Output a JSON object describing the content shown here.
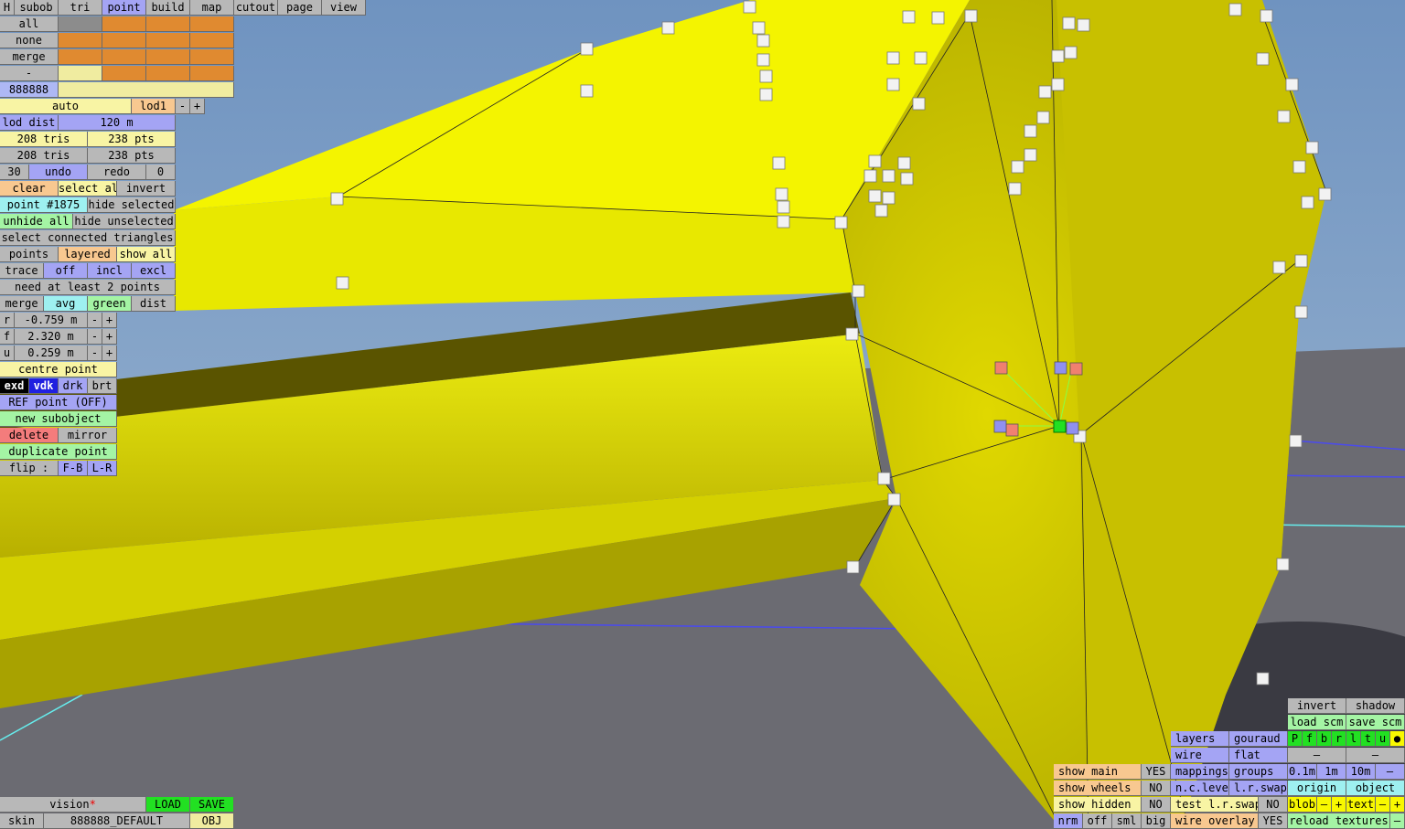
{
  "colors": {
    "sky": "#7a9cc4",
    "ground": "#6a6a72",
    "mesh": "#e8e800",
    "selected_point": "#22e022"
  },
  "menu": {
    "h": "H",
    "tabs": [
      "subob",
      "tri",
      "point",
      "build",
      "map",
      "cutout",
      "page",
      "view"
    ],
    "active": "point"
  },
  "select": {
    "all": "all",
    "none": "none",
    "merge": "merge",
    "dash": "-",
    "code": "888888"
  },
  "lod": {
    "auto": "auto",
    "name": "lod1",
    "minus": "-",
    "plus": "+",
    "dist_label": "lod dist",
    "dist_value": "120 m"
  },
  "stats": {
    "tris1": "208 tris",
    "pts1": "238 pts",
    "tris2": "208 tris",
    "pts2": "238 pts"
  },
  "undo": {
    "count": "30",
    "undo": "undo",
    "redo": "redo",
    "redo_count": "0"
  },
  "sel": {
    "clear": "clear",
    "select_all": "select all",
    "invert": "invert",
    "point": "point #1875",
    "hide_selected": "hide selected",
    "unhide_all": "unhide all",
    "hide_unselected": "hide unselected",
    "select_connected": "select connected triangles"
  },
  "view": {
    "points": "points",
    "layered": "layered",
    "show_all": "show all"
  },
  "trace": {
    "label": "trace",
    "off": "off",
    "incl": "incl",
    "excl": "excl",
    "need": "need at least 2 points"
  },
  "merge": {
    "label": "merge",
    "avg": "avg",
    "green": "green",
    "dist": "dist"
  },
  "coords": [
    {
      "axis": "r",
      "value": "-0.759 m"
    },
    {
      "axis": "f",
      "value": "2.320 m"
    },
    {
      "axis": "u",
      "value": "0.259 m"
    }
  ],
  "tools": {
    "centre": "centre point",
    "exd": "exd",
    "vdk": "vdk",
    "drk": "drk",
    "brt": "brt",
    "ref": "REF point (OFF)",
    "new_subobject": "new subobject",
    "delete": "delete",
    "mirror": "mirror",
    "duplicate": "duplicate point",
    "flip": "flip :",
    "fb": "F-B",
    "lr": "L-R"
  },
  "bottom_left": {
    "vision": "vision",
    "star": "*",
    "load": "LOAD",
    "save": "SAVE",
    "skin": "skin",
    "skin_value": "888888_DEFAULT",
    "obj": "OBJ"
  },
  "show": {
    "main": "show main",
    "main_v": "YES",
    "wheels": "show wheels",
    "wheels_v": "NO",
    "hidden": "show hidden",
    "hidden_v": "NO",
    "nrm": "nrm",
    "off": "off",
    "sml": "sml",
    "big": "big"
  },
  "render": {
    "layers": "layers",
    "gouraud": "gouraud",
    "wire": "wire",
    "flat": "flat",
    "mappings": "mappings",
    "groups": "groups",
    "nclevel": "n.c.level",
    "lrswap": "l.r.swap",
    "test_lrswap": "test l.r.swap",
    "test_v": "NO",
    "wire_overlay": "wire overlay",
    "wire_overlay_v": "YES"
  },
  "right": {
    "invert": "invert",
    "shadow": "shadow",
    "load_scm": "load scm",
    "save_scm": "save scm",
    "flags": [
      "P",
      "f",
      "b",
      "r",
      "l",
      "t",
      "u"
    ],
    "dot": "●",
    "dash": "–",
    "dash2": "–",
    "s01": "0.1m",
    "s1": "1m",
    "s10": "10m",
    "sminus": "–",
    "origin": "origin",
    "object": "object",
    "blob": "blob",
    "minus": "–",
    "plus": "+",
    "text": "text",
    "reload": "reload textures",
    "reload_minus": "–"
  }
}
